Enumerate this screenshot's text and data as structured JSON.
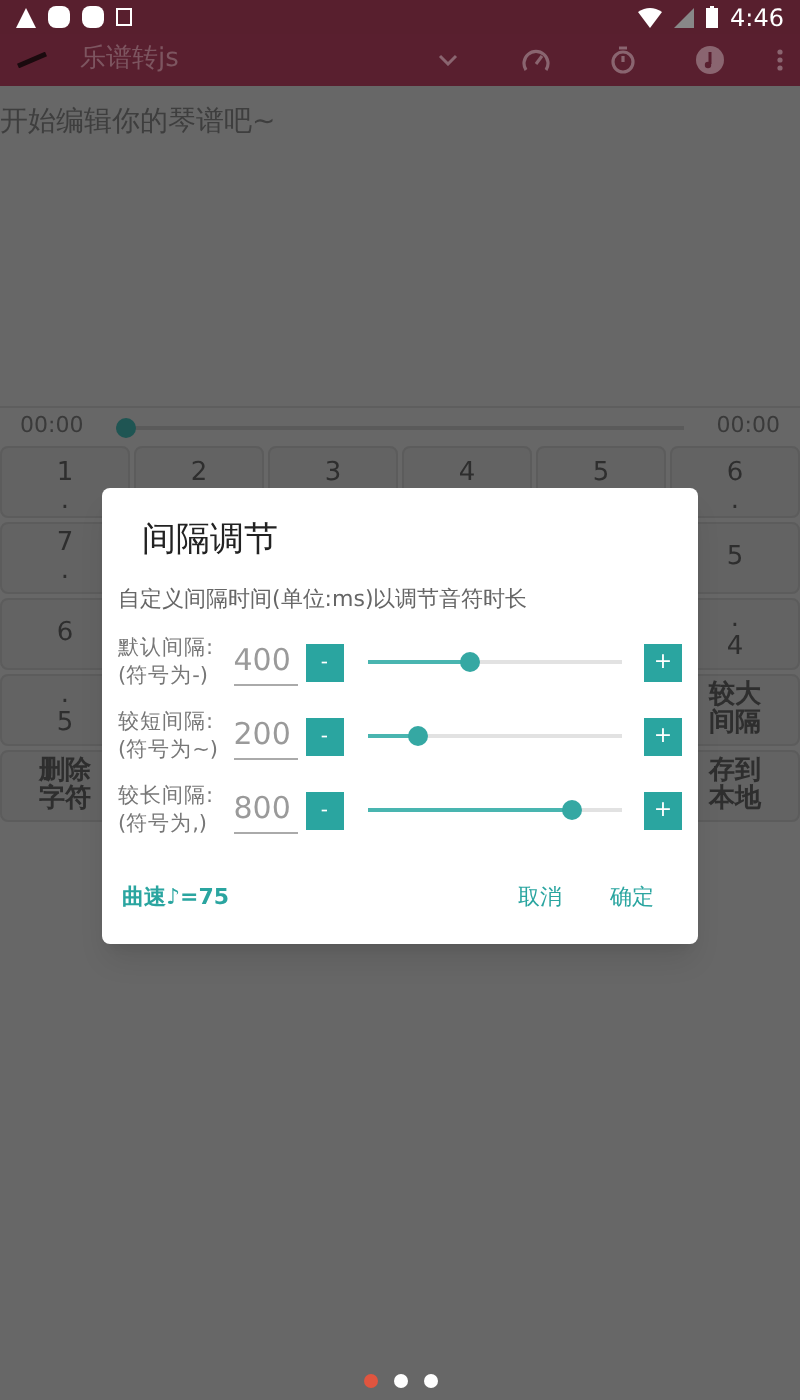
{
  "status_bar": {
    "time": "4:46"
  },
  "app_bar": {
    "title": "乐谱转js"
  },
  "editor": {
    "placeholder": "开始编辑你的琴谱吧~"
  },
  "player": {
    "elapsed": "00:00",
    "total": "00:00",
    "level": 0
  },
  "keys": [
    [
      {
        "kind": "note",
        "lines": [
          "1",
          "."
        ]
      },
      {
        "kind": "note",
        "lines": [
          "2"
        ]
      },
      {
        "kind": "note",
        "lines": [
          "3"
        ]
      },
      {
        "kind": "note",
        "lines": [
          "4"
        ]
      },
      {
        "kind": "note",
        "lines": [
          "5"
        ]
      },
      {
        "kind": "note",
        "lines": [
          "6",
          "."
        ]
      }
    ],
    [
      {
        "kind": "note",
        "lines": [
          "7",
          "."
        ]
      },
      {
        "kind": "blank"
      },
      {
        "kind": "blank"
      },
      {
        "kind": "blank"
      },
      {
        "kind": "blank"
      },
      {
        "kind": "note",
        "lines": [
          "5"
        ]
      }
    ],
    [
      {
        "kind": "note",
        "lines": [
          "6"
        ]
      },
      {
        "kind": "blank"
      },
      {
        "kind": "blank"
      },
      {
        "kind": "blank"
      },
      {
        "kind": "blank"
      },
      {
        "kind": "note",
        "lines": [
          ".",
          "4"
        ]
      }
    ],
    [
      {
        "kind": "note",
        "lines": [
          ".",
          "5"
        ]
      },
      {
        "kind": "blank"
      },
      {
        "kind": "blank"
      },
      {
        "kind": "blank"
      },
      {
        "kind": "blank"
      },
      {
        "kind": "action",
        "lines": [
          "较大",
          "间隔"
        ]
      }
    ],
    [
      {
        "kind": "action",
        "lines": [
          "删除",
          "字符"
        ]
      },
      {
        "kind": "blank"
      },
      {
        "kind": "blank"
      },
      {
        "kind": "blank"
      },
      {
        "kind": "blank"
      },
      {
        "kind": "action",
        "lines": [
          "存到",
          "本地"
        ]
      }
    ]
  ],
  "dialog": {
    "title": "间隔调节",
    "description": "自定义间隔时间(单位:ms)以调节音符时长",
    "intervals": [
      {
        "label": "默认间隔:",
        "symbol": "(符号为-)",
        "value": "400",
        "minus": "-",
        "plus": "+",
        "level": 0.4
      },
      {
        "label": "较短间隔:",
        "symbol": "(符号为~)",
        "value": "200",
        "minus": "-",
        "plus": "+",
        "level": 0.2
      },
      {
        "label": "较长间隔:",
        "symbol": "(符号为,)",
        "value": "800",
        "minus": "-",
        "plus": "+",
        "level": 0.8
      }
    ],
    "tempo": "曲速♪=75",
    "buttons": [
      "取消",
      "确定"
    ]
  },
  "pager": [
    {
      "selected": true
    },
    {
      "selected": false
    },
    {
      "selected": false
    }
  ]
}
